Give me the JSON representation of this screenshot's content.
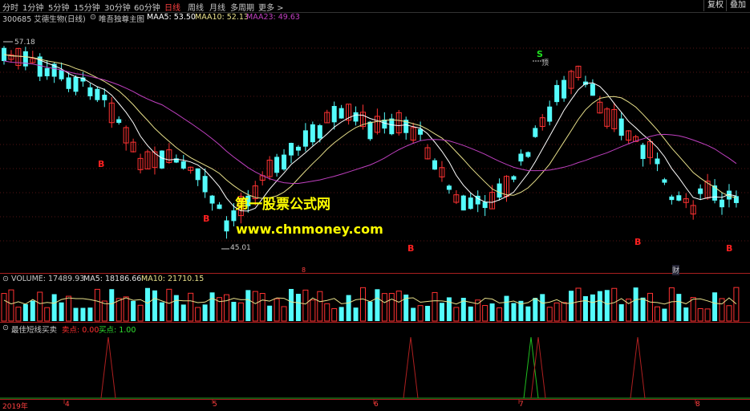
{
  "toolbar": {
    "periods": [
      "分时",
      "1分钟",
      "5分钟",
      "15分钟",
      "30分钟",
      "60分钟",
      "日线",
      "周线",
      "月线",
      "多周期",
      "更多 >"
    ],
    "active_index": 6,
    "right_buttons": [
      "复权",
      "叠加"
    ]
  },
  "main_header": {
    "code_name": "300685 艾德生物(日线)",
    "indicator": "唯吾独尊主图",
    "maa5": "MAA5: 53.50",
    "maa10": "MAA10: 52.13",
    "maa23": "MAA23: 49.63"
  },
  "main_panel": {
    "high_label": "57.18",
    "low_label": "45.01",
    "top_marker": "S",
    "top_text": "顶",
    "buy_marker": "B",
    "watermark_cn": "第一股票公式网",
    "watermark_url": "www.chnmoney.com",
    "bottom_markers": [
      "8",
      "财"
    ]
  },
  "volume_header": {
    "title": "VOLUME: 17489.93",
    "ma5": "MA5: 18186.66",
    "ma10": "MA10: 21710.15"
  },
  "signal_header": {
    "title": "最佳短线买卖",
    "sell": "卖点: 0.00",
    "buy": "买点: 1.00"
  },
  "time_axis": [
    "2019年",
    "4",
    "5",
    "6",
    "7",
    "8"
  ],
  "colors": {
    "up": "#ff3232",
    "down": "#54fcfc",
    "maa5": "#ffffff",
    "maa10": "#e8e08a",
    "maa23": "#c040c0",
    "watermark_cn": "#ffff00",
    "watermark_url": "#ffff00",
    "buy_marker": "#ff2020",
    "top_marker": "#20e020"
  }
}
